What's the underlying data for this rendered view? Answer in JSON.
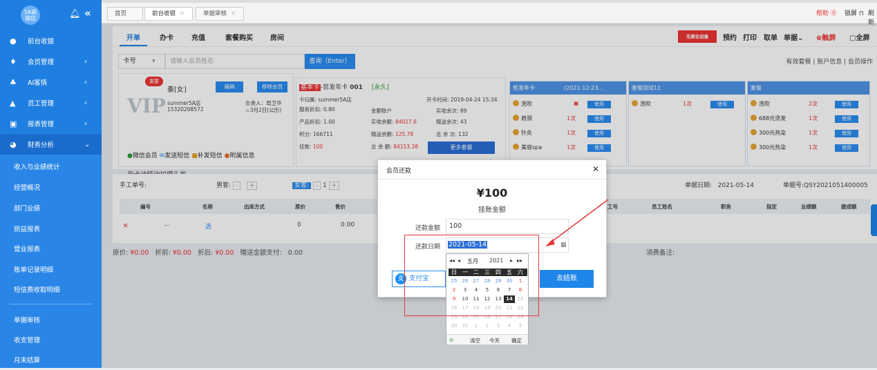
{
  "sidebar": {
    "logo_line1": "5A高",
    "logo_line2": "端店",
    "items": [
      {
        "label": "前台收银"
      },
      {
        "label": "会员管理"
      },
      {
        "label": "AI客情"
      },
      {
        "label": "员工管理"
      },
      {
        "label": "报表管理"
      },
      {
        "label": "财务分析"
      }
    ],
    "sub_items": [
      {
        "label": "收入与业绩统计"
      },
      {
        "label": "经营概况"
      },
      {
        "label": "部门业绩"
      },
      {
        "label": "损益报表"
      },
      {
        "label": "营业报表"
      },
      {
        "label": "账单记录明细"
      },
      {
        "label": "短信费收取明细"
      },
      {
        "label": "单据审核"
      },
      {
        "label": "收支管理"
      },
      {
        "label": "月末结算"
      }
    ]
  },
  "tabs": [
    {
      "label": "首页"
    },
    {
      "label": "前台收银"
    },
    {
      "label": "单据审核"
    }
  ],
  "topbar": {
    "help": "帮助",
    "lock": "锁屏",
    "refresh": "刷新"
  },
  "optabs": [
    "开单",
    "办卡",
    "充值",
    "套餐购买",
    "房间"
  ],
  "tools": {
    "device": "无感化设备",
    "book": "预约",
    "print": "打印",
    "takeorder": "取单",
    "document": "单据",
    "pin": "触屏",
    "fullscreen": "全屏"
  },
  "search": {
    "type": "卡号",
    "placeholder": "请输入会员姓名",
    "button": "查询（Enter）"
  },
  "right_links": "有效套餐 | 账户信息 | 会员操作",
  "member": {
    "badge": "重要",
    "vip": "VIP",
    "name": "秦[女]",
    "edit": "编辑",
    "remove": "移除会员",
    "store": "summer5A店",
    "phone": "15320208572",
    "owner": "负责人：周卫华",
    "birthday": "3月2日(公历)",
    "links": [
      "微信会员",
      "发送短信",
      "补发短信",
      "附属信息"
    ],
    "note": "用卡诗精油护理头发"
  },
  "card": {
    "tag": "基本卡",
    "title": "-剪发年卡",
    "no": "001",
    "validity": "[永久]",
    "store": "卡归属: summer5A店",
    "open_time": "开卡时间: 2019-04-24 15:34",
    "service_discount": "服务折扣: 0.80",
    "product_discount": "产品折扣: 1.00",
    "points": "积分: 166711",
    "arrears_label": "挂账:",
    "arrears": "100",
    "account_label": "金额账户",
    "real_balance_label": "实收余额:",
    "real_balance": "84027.6",
    "gift_balance_label": "赠送余额:",
    "gift_balance": "125.78",
    "total_balance_label": "总 余 额:",
    "total_balance": "84153.38",
    "real_times": "实收余次: 89",
    "gift_times": "赠送余次: 43",
    "total_times": "总 余 次: 132",
    "more": "更多套餐"
  },
  "packages": [
    {
      "title": "剪发年卡",
      "date": "(2021-12-23...",
      "items": [
        {
          "name": "洗吹",
          "count": ""
        },
        {
          "name": "肩颈",
          "count": "1次"
        },
        {
          "name": "针灸",
          "count": "1次"
        },
        {
          "name": "美容spa",
          "count": "1次"
        }
      ]
    },
    {
      "title": "套餐测试11",
      "items": [
        {
          "name": "洗吹",
          "count": "1次"
        }
      ]
    },
    {
      "title": "套餐",
      "items": [
        {
          "name": "洗吹",
          "count": "2次"
        },
        {
          "name": "688元烫发",
          "count": "1次"
        },
        {
          "name": "300元热染",
          "count": "1次"
        },
        {
          "name": "300元热染",
          "count": "1次"
        }
      ]
    }
  ],
  "use_label": "使用",
  "order": {
    "manual_label": "手工单号:",
    "male_label": "男客:",
    "female_label": "女客:",
    "female_count": "1",
    "date_label": "单据日期:",
    "date": "2021-05-14",
    "no_label": "单据号:",
    "no": "QSY2021051400005",
    "headers": [
      "编号",
      "名称",
      "出库方式",
      "原价",
      "售价",
      "工号",
      "员工姓名",
      "职务",
      "指定",
      "业绩额",
      "提成额"
    ],
    "row": {
      "delete": "×",
      "dots": "...",
      "name": "选",
      "orig": "0",
      "price": "0.00"
    }
  },
  "summary": {
    "orig_label": "原价:",
    "orig": "¥0.00",
    "before_label": "折前:",
    "before": "¥0.00",
    "after_label": "折后:",
    "after": "¥0.00",
    "gift_label": "赠送金额支付:",
    "gift": "0.00",
    "fee_note_label": "消费备注:"
  },
  "modal": {
    "title": "会员还款",
    "amount": "¥100",
    "amount_label": "挂账金额",
    "pay_amount_label": "还款金额",
    "pay_amount": "100",
    "pay_date_label": "还款日期",
    "pay_date": "2021-05-14",
    "alipay": "支付宝",
    "checkout": "去结账"
  },
  "calendar": {
    "month": "五月",
    "year": "2021",
    "weekdays": [
      "日",
      "一",
      "二",
      "三",
      "四",
      "五",
      "六"
    ],
    "days": [
      [
        "25",
        "26",
        "27",
        "28",
        "29",
        "30",
        "1"
      ],
      [
        "2",
        "3",
        "4",
        "5",
        "6",
        "7",
        "8"
      ],
      [
        "9",
        "10",
        "11",
        "12",
        "13",
        "14",
        "15"
      ],
      [
        "16",
        "17",
        "18",
        "19",
        "20",
        "21",
        "22"
      ],
      [
        "23",
        "24",
        "25",
        "26",
        "27",
        "28",
        "29"
      ],
      [
        "30",
        "31",
        "1",
        "2",
        "3",
        "4",
        "5"
      ]
    ],
    "selected_day": "14",
    "clear": "清空",
    "today": "今天",
    "ok": "确定"
  },
  "colors": {
    "sidebar": "#1f7fe0",
    "accent": "#2a8cf0",
    "highlight": "#e53a3a"
  }
}
